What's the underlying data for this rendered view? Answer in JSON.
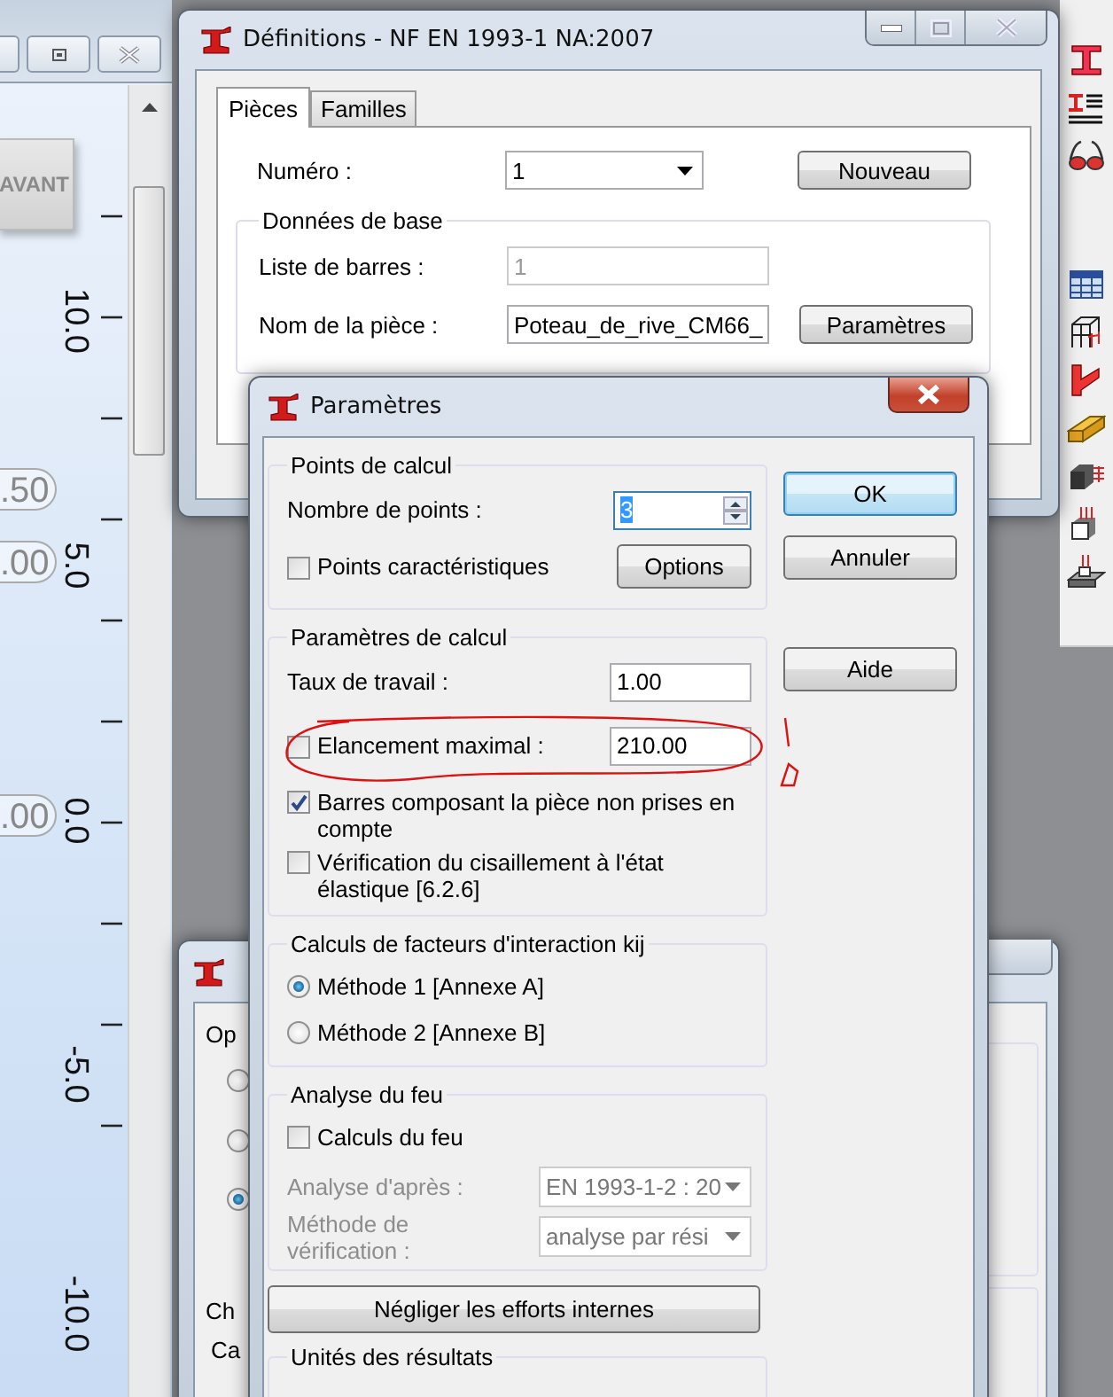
{
  "background_app": {
    "button": "AVANT",
    "ruler_labels": [
      "10.0",
      "5.0",
      "0.0",
      "-5.0",
      "-10.0"
    ],
    "value_pills": [
      ".50",
      ".00",
      ".00"
    ]
  },
  "definitions_window": {
    "title": "Définitions - NF EN 1993-1 NA:2007",
    "tabs": [
      {
        "label": "Pièces",
        "selected": true
      },
      {
        "label": "Familles",
        "selected": false
      }
    ],
    "numero": {
      "label": "Numéro :",
      "value": "1"
    },
    "new_button": "Nouveau",
    "group_title": "Données de base",
    "bar_list": {
      "label": "Liste de barres :",
      "value": "1",
      "disabled": true
    },
    "member_name": {
      "label": "Nom de la pièce :",
      "value": "Poteau_de_rive_CM66_"
    },
    "parameters_button": "Paramètres"
  },
  "back_window": {
    "labels": [
      "Op",
      "Ch",
      "Ca"
    ],
    "radios": [
      {
        "selected": false
      },
      {
        "selected": false
      },
      {
        "selected": true
      }
    ]
  },
  "parameters_dialog": {
    "title": "Paramètres",
    "points_group": {
      "title": "Points de calcul",
      "count_label": "Nombre de points :",
      "count_value": "3",
      "value_selected": true,
      "characteristic": {
        "label": "Points caractéristiques",
        "checked": false
      },
      "options_button": "Options"
    },
    "calc_group": {
      "title": "Paramètres de calcul",
      "rows": [
        {
          "kind": "field",
          "label": "Taux de travail :",
          "value": "1.00"
        },
        {
          "kind": "checkfield",
          "label": "Elancement maximal :",
          "value": "210.00",
          "checked": false
        },
        {
          "kind": "checkbox",
          "label": "Barres composant la pièce non prises en compte",
          "checked": true
        },
        {
          "kind": "checkbox",
          "label": "Vérification du cisaillement à l'état élastique [6.2.6]",
          "checked": false
        }
      ]
    },
    "interaction_group": {
      "title": "Calculs de facteurs d'interaction kij",
      "options": [
        {
          "label": "Méthode 1 [Annexe A]",
          "selected": true
        },
        {
          "label": "Méthode 2 [Annexe B]",
          "selected": false
        }
      ]
    },
    "fire_group": {
      "title": "Analyse du feu",
      "fire_calc": {
        "label": "Calculs du feu",
        "checked": false
      },
      "rows": [
        {
          "label": "Analyse d'après :",
          "value": "EN 1993-1-2 : 20",
          "disabled": true
        },
        {
          "label": "Méthode de vérification :",
          "value": "analyse par rési",
          "disabled": true
        }
      ]
    },
    "neglect_button": "Négliger les efforts internes",
    "units_group": {
      "title": "Unités des résultats"
    },
    "buttons": [
      {
        "label": "OK",
        "default": true
      },
      {
        "label": "Annuler",
        "default": false
      },
      {
        "label": "Aide",
        "default": false
      }
    ]
  }
}
